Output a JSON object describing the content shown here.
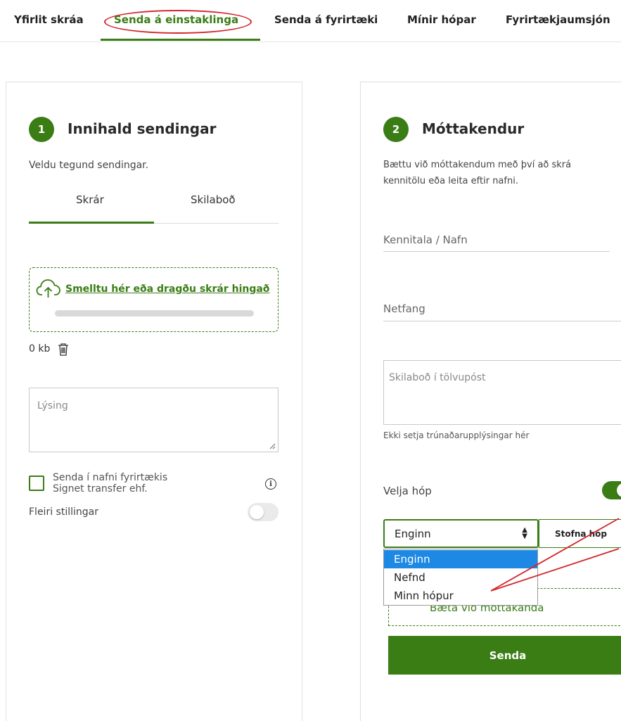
{
  "nav": {
    "items": [
      {
        "label": "Yfirlit skráa"
      },
      {
        "label": "Senda á einstaklinga"
      },
      {
        "label": "Senda á fyrirtæki"
      },
      {
        "label": "Mínir hópar"
      },
      {
        "label": "Fyrirtækjaumsjón"
      }
    ],
    "active_index": 1
  },
  "content": {
    "step": "1",
    "title": "Innihald sendingar",
    "subtitle": "Veldu tegund sendingar.",
    "tabs": [
      {
        "label": "Skrár"
      },
      {
        "label": "Skilaboð"
      }
    ],
    "upload": {
      "link_text": "Smelltu hér eða dragðu skrár hingað",
      "progress": 0
    },
    "file_size": "0 kb",
    "description_placeholder": "Lýsing",
    "company_checkbox": {
      "label": "Senda í nafni fyrirtækis",
      "sublabel": "Signet transfer ehf.",
      "checked": false
    },
    "more_settings": {
      "label": "Fleiri stillingar",
      "enabled": false
    }
  },
  "recipients": {
    "step": "2",
    "title": "Móttakendur",
    "help_line1": "Bættu við móttakendum með því að skrá",
    "help_line2": "kennitölu eða leita eftir nafni.",
    "id_placeholder": "Kennitala / Nafn",
    "email_placeholder": "Netfang",
    "message_placeholder": "Skilaboð í tölvupóst",
    "message_hint": "Ekki setja trúnaðarupplýsingar hér",
    "group_toggle": {
      "label": "Velja hóp",
      "enabled": true
    },
    "group_select": {
      "value": "Enginn",
      "options": [
        "Enginn",
        "Nefnd",
        "Minn hópur"
      ]
    },
    "create_group_label": "Stofna hóp",
    "add_recipient_label": "Bæta við móttakanda",
    "send_label": "Senda"
  },
  "colors": {
    "accent": "#3a7d15",
    "annotation": "#d2262b",
    "dropdown_highlight": "#1e88e5"
  }
}
